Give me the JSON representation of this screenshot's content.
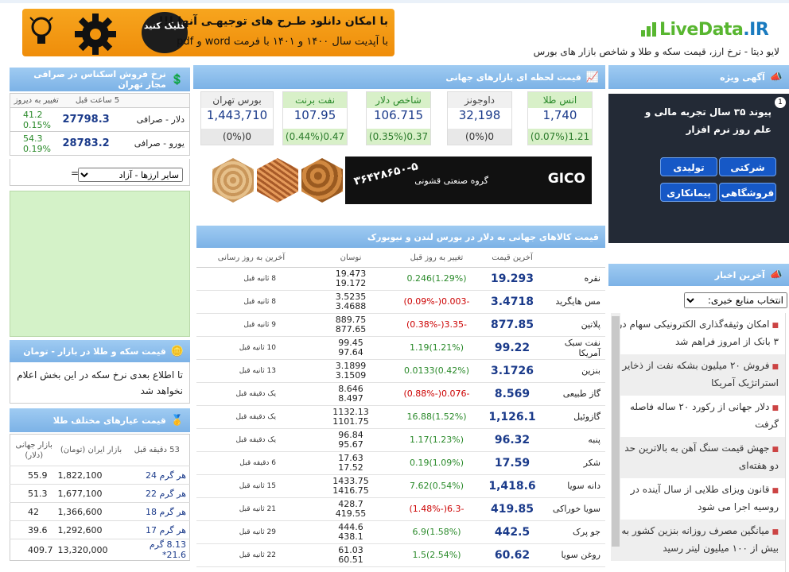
{
  "header": {
    "logo_text": "LiveData",
    "logo_tld": ".IR",
    "tagline": "لایو دیتا - نرخ ارز، قیمت سکه و طلا و شاخص بازار های بورس",
    "banner": {
      "line1": "با امکان دانلود طـرح های توجیهـی آنها !!!",
      "line2": "با آپدیت سال ۱۴۰۰ و ۱۴۰۱ با فرمت word و pdf",
      "click": "کلیک کنید"
    }
  },
  "special_ad": {
    "title": "آگهی ویژه",
    "number": "1",
    "headline": "پیوند ۳۵ سال تجربه مالی و علم روز نرم افزار",
    "pills": [
      "شرکتی",
      "تولیدی",
      "فروشگاهی",
      "پیمانکاری"
    ]
  },
  "news": {
    "title": "آخرین اخبار",
    "select_value": "انتخاب منابع خبری:",
    "items": [
      "امکان وثیقه‌گذاری الکترونیکی سهام در ۳ بانک از امروز فراهم شد",
      "فروش ۲۰ میلیون بشکه نفت از ذخایر استراتژیک آمریکا",
      "دلار جهانی از رکورد ۲۰ ساله فاصله گرفت",
      "جهش قیمت سنگ آهن به بالاترین حد دو هفته‌ای",
      "قانون ویزای طلایی از سال آینده در روسیه اجرا می شود",
      "میانگین مصرف روزانه بنزین کشور به بیش از ۱۰۰ میلیون لیتر رسید"
    ]
  },
  "world_markets": {
    "title": "قیمت لحظه ای بازارهای جهانی",
    "cells": [
      {
        "label": "انس طلا",
        "value": "1,740",
        "change": "1.21(0.07%)",
        "style": "green"
      },
      {
        "label": "داوجونز",
        "value": "32,198",
        "change": "0(0%)",
        "style": "gray"
      },
      {
        "label": "شاخص دلار",
        "value": "106.715",
        "change": "0.37(0.35%)",
        "style": "green"
      },
      {
        "label": "نفت برنت",
        "value": "107.95",
        "change": "0.47(0.44%)",
        "style": "green"
      },
      {
        "label": "بورس تهران",
        "value": "1,443,710",
        "change": "0(0%)",
        "style": "gray"
      }
    ]
  },
  "gico_ad": {
    "name": "GICO",
    "subtitle": "گروه صنعتی قشونی",
    "phone": "۳۶۴۲۸۶۵۰-۵"
  },
  "commodities": {
    "title": "قیمت کالاهای جهانی به دلار در بورس لندن و نیویورک",
    "headers": [
      "",
      "آخرین قیمت",
      "تغییر به روز قبل",
      "نوسان",
      "آخرین به روز رسانی"
    ],
    "rows": [
      {
        "name": "نقره",
        "price": "19.293",
        "change": "(1.29%)0.246",
        "dir": "up",
        "high": "19.473",
        "low": "19.172",
        "updated": "8 ثانیه قبل"
      },
      {
        "name": "مس هایگرید",
        "price": "3.4718",
        "change": "-0.003(-0.09%)",
        "dir": "dn",
        "high": "3.5235",
        "low": "3.4688",
        "updated": "8 ثانیه قبل"
      },
      {
        "name": "پلاتین",
        "price": "877.85",
        "change": "-3.35(-0.38%)",
        "dir": "dn",
        "high": "889.75",
        "low": "877.65",
        "updated": "9 ثانیه قبل"
      },
      {
        "name": "نفت سبک آمریکا",
        "price": "99.22",
        "change": "(1.21%)1.19",
        "dir": "up",
        "high": "99.45",
        "low": "97.64",
        "updated": "10 ثانیه قبل"
      },
      {
        "name": "بنزین",
        "price": "3.1726",
        "change": "(0.42%)0.0133",
        "dir": "up",
        "high": "3.1899",
        "low": "3.1509",
        "updated": "13 ثانیه قبل"
      },
      {
        "name": "گاز طبیعی",
        "price": "8.569",
        "change": "-0.076(-0.88%)",
        "dir": "dn",
        "high": "8.646",
        "low": "8.497",
        "updated": "یک دقیقه قبل"
      },
      {
        "name": "گازوئیل",
        "price": "1,126.1",
        "change": "(1.52%)16.88",
        "dir": "up",
        "high": "1132.13",
        "low": "1101.75",
        "updated": "یک دقیقه قبل"
      },
      {
        "name": "پنبه",
        "price": "96.32",
        "change": "(1.23%)1.17",
        "dir": "up",
        "high": "96.84",
        "low": "95.67",
        "updated": "یک دقیقه قبل"
      },
      {
        "name": "شکر",
        "price": "17.59",
        "change": "(1.09%)0.19",
        "dir": "up",
        "high": "17.63",
        "low": "17.52",
        "updated": "6 دقیقه قبل"
      },
      {
        "name": "دانه سویا",
        "price": "1,418.6",
        "change": "(0.54%)7.62",
        "dir": "up",
        "high": "1433.75",
        "low": "1416.75",
        "updated": "15 ثانیه قبل"
      },
      {
        "name": "سویا خوراکی",
        "price": "419.85",
        "change": "-6.3(-1.48%)",
        "dir": "dn",
        "high": "428.7",
        "low": "419.55",
        "updated": "21 ثانیه قبل"
      },
      {
        "name": "جو پرک",
        "price": "442.5",
        "change": "(1.58%)6.9",
        "dir": "up",
        "high": "444.6",
        "low": "438.1",
        "updated": "29 ثانیه قبل"
      },
      {
        "name": "روغن سویا",
        "price": "60.62",
        "change": "(2.54%)1.5",
        "dir": "up",
        "high": "61.03",
        "low": "60.51",
        "updated": "22 ثانیه قبل"
      }
    ]
  },
  "exchange": {
    "title": "نرخ فروش اسکناس در صرافی مجاز تهران",
    "headers": [
      "",
      "5 ساعت قبل",
      "تغییر به دیروز"
    ],
    "rows": [
      {
        "name": "دلار - صرافی",
        "price": "27798.3",
        "chg_abs": "41.2",
        "chg_pct": "0.15%"
      },
      {
        "name": "یورو - صرافی",
        "price": "28783.2",
        "chg_abs": "54.3",
        "chg_pct": "0.19%"
      }
    ],
    "select_value": "سایر ارزها - آزاد",
    "eq": "="
  },
  "coin": {
    "title": "قیمت سکه و طلا در بازار - تومان",
    "text": "تا اطلاع بعدی نرخ سکه در این بخش اعلام نخواهد شد"
  },
  "gold": {
    "title": "قیمت عیارهای مختلف طلا",
    "headers": [
      "53 دقیقه قبل",
      "بازار ایران (تومان)",
      "بازار جهانی (دلار)"
    ],
    "rows": [
      {
        "name": "هر گرم 24",
        "iran": "1,822,100",
        "world": "55.9"
      },
      {
        "name": "هر گرم 22",
        "iran": "1,677,100",
        "world": "51.3"
      },
      {
        "name": "هر گرم 18",
        "iran": "1,366,600",
        "world": "42"
      },
      {
        "name": "هر گرم 17",
        "iran": "1,292,600",
        "world": "39.6"
      },
      {
        "name": "8.13 گرم 21.6*",
        "iran": "13,320,000",
        "world": "409.7"
      }
    ]
  }
}
